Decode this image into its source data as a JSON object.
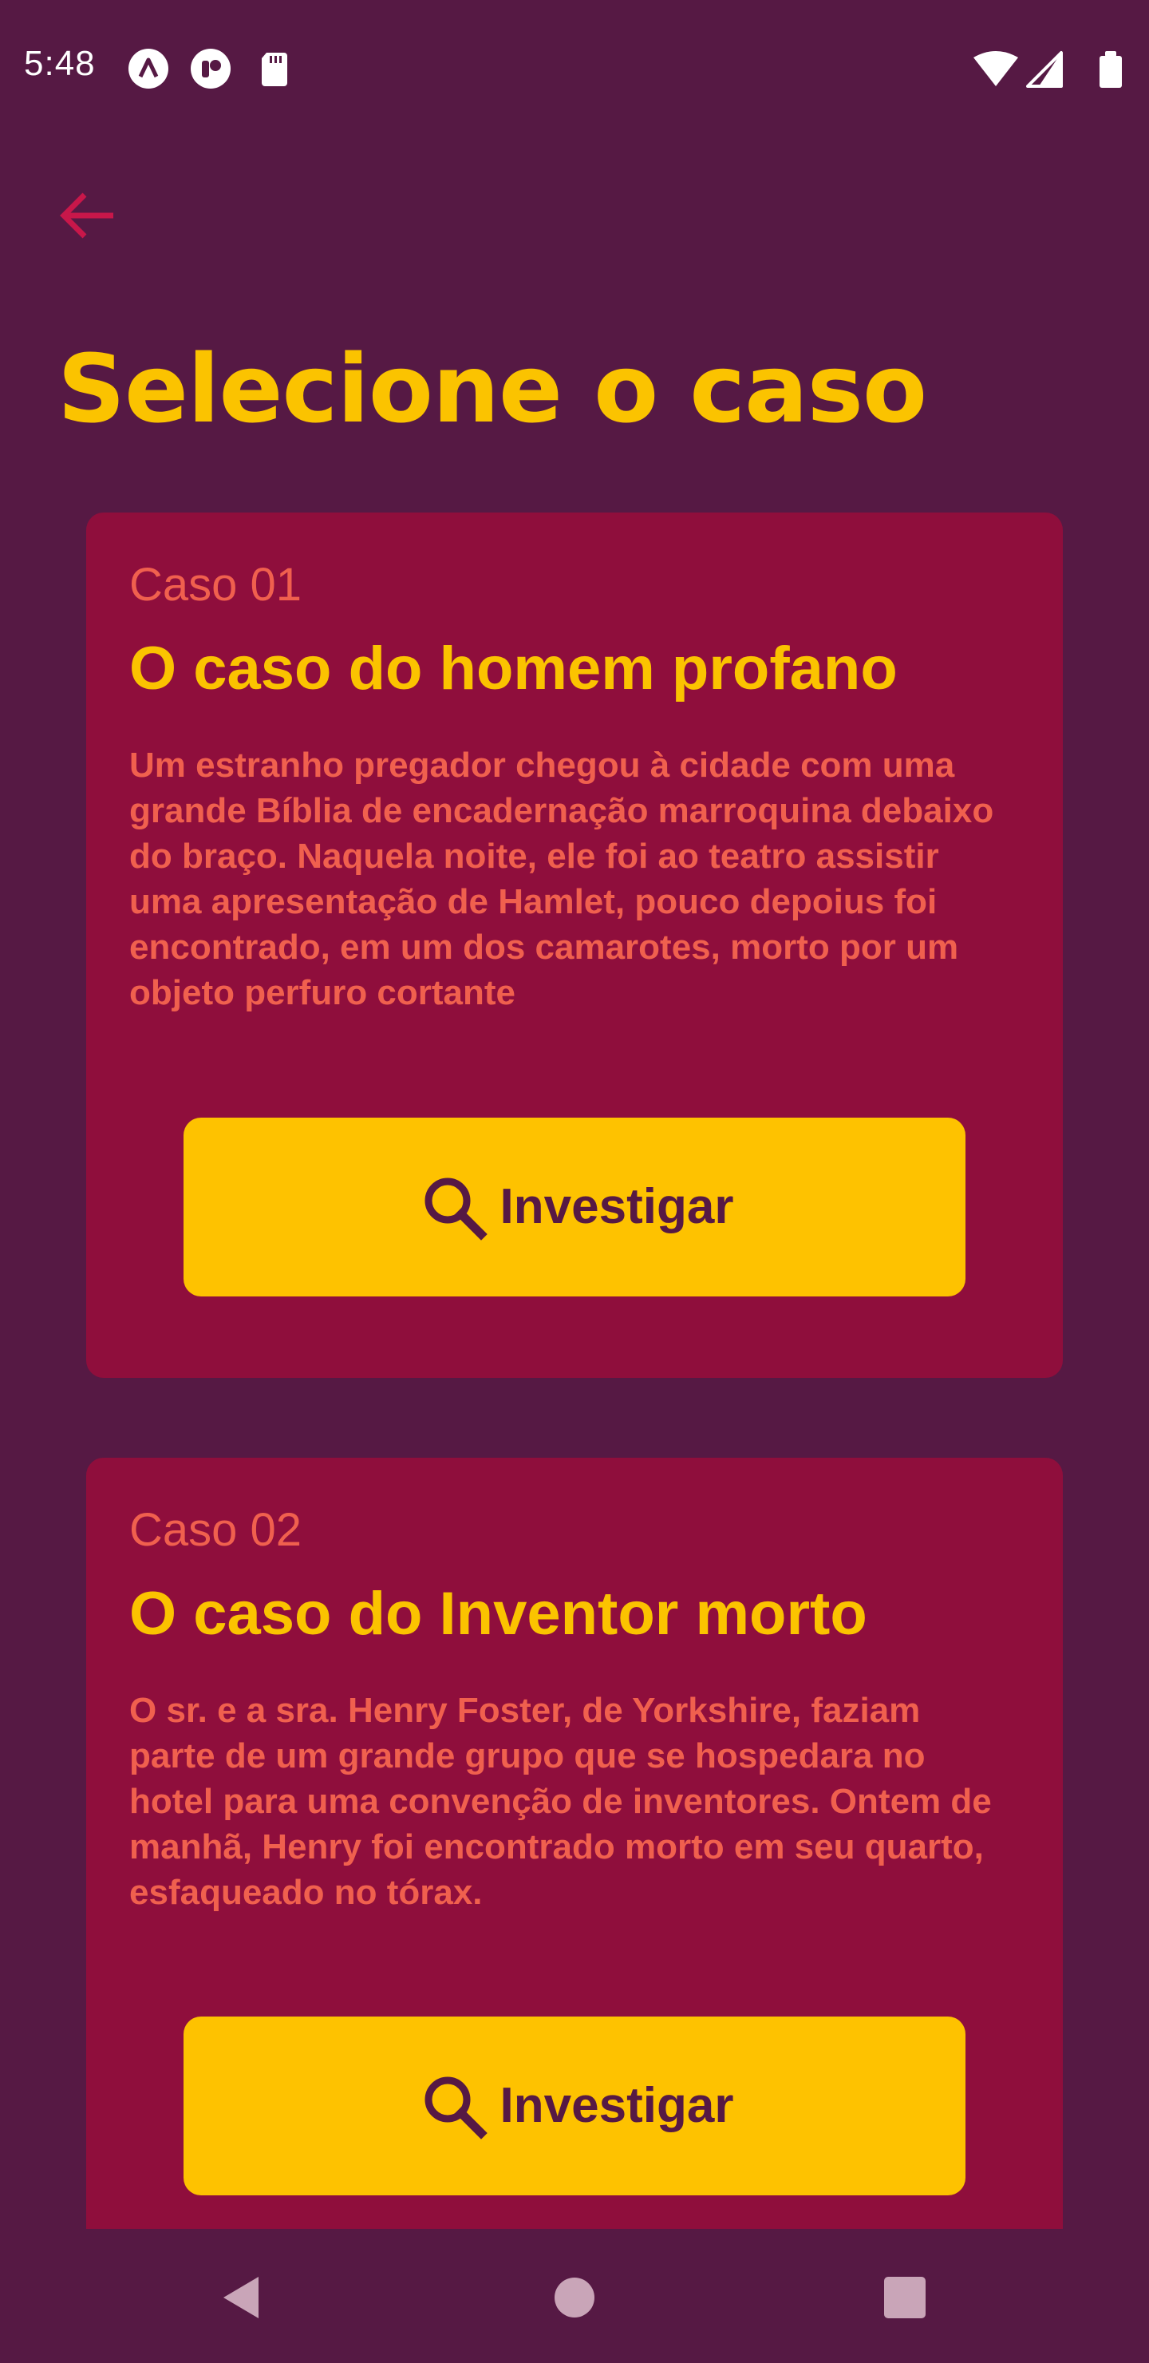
{
  "status_bar": {
    "time": "5:48",
    "left_icons": [
      "autofill-icon",
      "app-notification-icon",
      "sd-card-icon"
    ],
    "right_icons": [
      "wifi-icon",
      "cell-signal-icon",
      "battery-icon"
    ]
  },
  "header": {
    "back_icon": "arrow-left-icon",
    "title": "Selecione o caso"
  },
  "cases": [
    {
      "number": "Caso 01",
      "title": "O caso do homem profano",
      "description": "Um estranho pregador chegou à cidade com uma grande Bíblia de encadernação marroquina debaixo do braço. Naquela noite, ele foi ao teatro assistir uma apresentação de Hamlet, pouco depoius foi encontrado, em um dos camarotes, morto por um objeto perfuro cortante",
      "button_label": "Investigar",
      "button_icon": "search-icon"
    },
    {
      "number": "Caso 02",
      "title": "O caso do Inventor morto",
      "description": "O sr. e a sra. Henry Foster, de Yorkshire, faziam parte de um grande grupo que se hospedara no hotel para uma convenção de inventores. Ontem de manhã, Henry foi encontrado morto em seu quarto, esfaqueado no tórax.",
      "button_label": "Investigar",
      "button_icon": "search-icon"
    }
  ],
  "colors": {
    "background": "#561944",
    "card": "#8f0e3c",
    "accent_yellow": "#fbc300",
    "text_coral": "#f0604e",
    "back_arrow": "#c8174a"
  },
  "nav_bar": {
    "buttons": [
      "back-triangle-icon",
      "home-circle-icon",
      "recents-square-icon"
    ]
  }
}
